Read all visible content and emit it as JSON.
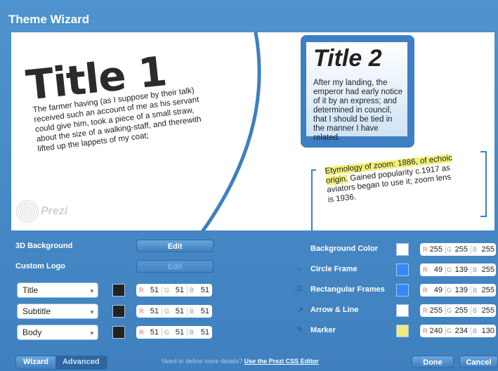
{
  "window": {
    "title": "Theme Wizard"
  },
  "preview": {
    "title1": "Title 1",
    "title1_body": "The farmer having (as I suppose by their talk) received such an account of me as his servant could give him, took a piece of a small straw, about the size of a walking-staff, and therewith lifted up the lappets of my coat;",
    "title2": "Title 2",
    "title2_body": "After my landing, the emperor had early notice of it by an express; and determined in council, that I should be tied in the manner I have related.",
    "etym_highlight": "Etymology of zoom: 1886, of echoic origin.",
    "etym_rest": " Gained popularity c.1917 as aviators began to use it; zoom lens is 1936.",
    "logo_text": "Prezi"
  },
  "left_panel": {
    "bg3d_label": "3D Background",
    "bg3d_button": "Edit",
    "custom_logo_label": "Custom Logo",
    "custom_logo_button": "Edit",
    "fonts": [
      {
        "label": "Title",
        "swatch": "#222222",
        "r": "51",
        "g": "51",
        "b": "51"
      },
      {
        "label": "Subtitle",
        "swatch": "#222222",
        "r": "51",
        "g": "51",
        "b": "51"
      },
      {
        "label": "Body",
        "swatch": "#222222",
        "r": "51",
        "g": "51",
        "b": "51"
      }
    ]
  },
  "right_panel": {
    "rows": [
      {
        "label": "Background Color",
        "icon": "",
        "swatch": "#ffffff",
        "r": "255",
        "g": "255",
        "b": "255"
      },
      {
        "label": "Circle Frame",
        "icon": "circle-frame-icon",
        "swatch": "#318bff",
        "r": "49",
        "g": "139",
        "b": "255"
      },
      {
        "label": "Rectangular Frames",
        "icon": "rectangular-frames-icon",
        "swatch": "#318bff",
        "r": "49",
        "g": "139",
        "b": "255"
      },
      {
        "label": "Arrow & Line",
        "icon": "arrow-line-icon",
        "swatch": "#ffffff",
        "r": "255",
        "g": "255",
        "b": "255"
      },
      {
        "label": "Marker",
        "icon": "marker-icon",
        "swatch": "#f0ea82",
        "r": "240",
        "g": "234",
        "b": "130"
      }
    ]
  },
  "bottom": {
    "tab_wizard": "Wizard",
    "tab_advanced": "Advanced",
    "hint": "Need to define more details?",
    "hint_link": "Use the Prezi CSS Editor",
    "done": "Done",
    "cancel": "Cancel"
  }
}
